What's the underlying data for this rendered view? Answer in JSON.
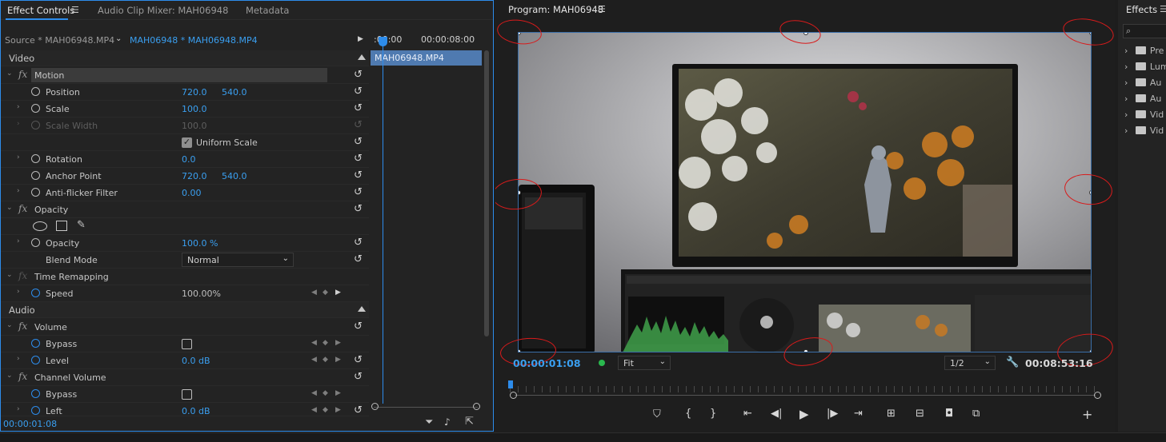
{
  "effect_controls": {
    "tabs": [
      "Effect Controls",
      "Audio Clip Mixer: MAH06948",
      "Metadata"
    ],
    "source_label": "Source * MAH06948.MP4",
    "sequence_clip": "MAH06948 * MAH06948.MP4",
    "timeline_start": ":00:00",
    "timeline_end": "00:00:08:00",
    "clip_name": "MAH06948.MP4",
    "current_time": "00:00:01:08",
    "video_section": "Video",
    "audio_section": "Audio",
    "motion": {
      "name": "Motion",
      "position_label": "Position",
      "position_x": "720.0",
      "position_y": "540.0",
      "scale_label": "Scale",
      "scale": "100.0",
      "scale_width_label": "Scale Width",
      "scale_width": "100.0",
      "uniform_scale_label": "Uniform Scale",
      "rotation_label": "Rotation",
      "rotation": "0.0",
      "anchor_label": "Anchor Point",
      "anchor_x": "720.0",
      "anchor_y": "540.0",
      "antiflicker_label": "Anti-flicker Filter",
      "antiflicker": "0.00"
    },
    "opacity": {
      "name": "Opacity",
      "opacity_label": "Opacity",
      "opacity": "100.0 %",
      "blend_label": "Blend Mode",
      "blend": "Normal"
    },
    "time_remapping": {
      "name": "Time Remapping",
      "speed_label": "Speed",
      "speed": "100.00%"
    },
    "volume": {
      "name": "Volume",
      "bypass_label": "Bypass",
      "level_label": "Level",
      "level": "0.0 dB"
    },
    "channel_volume": {
      "name": "Channel Volume",
      "bypass_label": "Bypass",
      "left_label": "Left",
      "left": "0.0 dB"
    }
  },
  "program_monitor": {
    "title": "Program: MAH06948",
    "current_time": "00:00:01:08",
    "fit_label": "Fit",
    "resolution": "1/2",
    "duration": "00:08:53:16"
  },
  "effects_panel": {
    "title": "Effects",
    "items": [
      "Pre",
      "Lum",
      "Au",
      "Au",
      "Vid",
      "Vid"
    ]
  },
  "colors": {
    "accent": "#2d8ceb",
    "annotation": "#d91b1b",
    "value_blue": "#3a9ff0"
  }
}
